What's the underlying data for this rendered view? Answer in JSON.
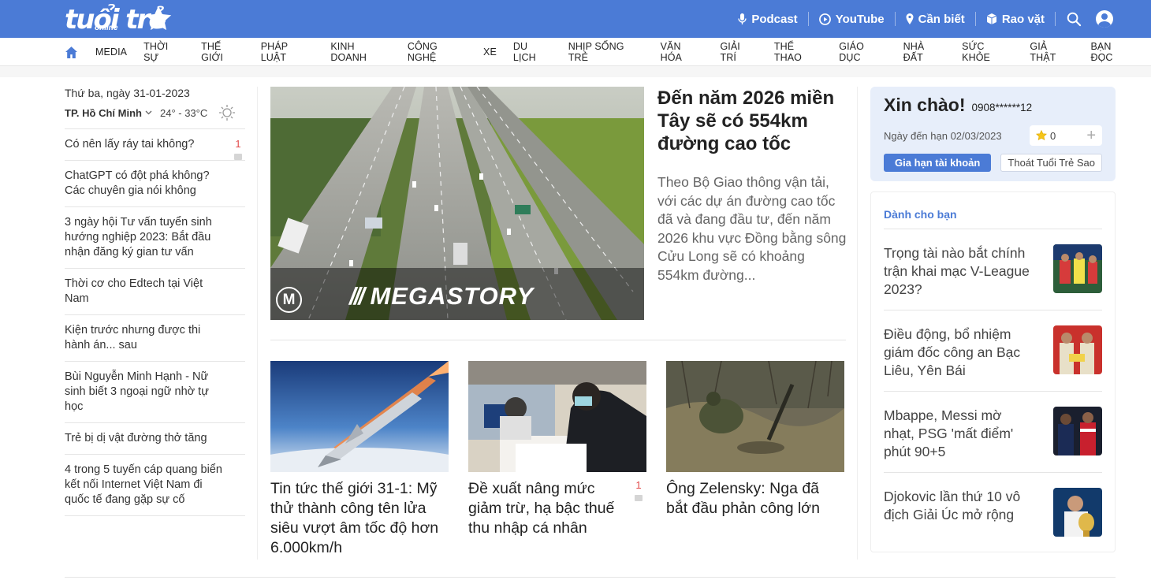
{
  "brand": {
    "logo_text": "tuổi trẻ",
    "logo_sub": "online",
    "color_primary": "#4b7bd6"
  },
  "topnav": {
    "links": [
      {
        "label": "Podcast",
        "icon": "microphone-icon"
      },
      {
        "label": "YouTube",
        "icon": "youtube-icon"
      },
      {
        "label": "Cần biết",
        "icon": "pin-icon"
      },
      {
        "label": "Rao vặt",
        "icon": "cube-icon"
      }
    ]
  },
  "categories": [
    "MEDIA",
    "THỜI SỰ",
    "THẾ GIỚI",
    "PHÁP LUẬT",
    "KINH DOANH",
    "CÔNG NGHỆ",
    "XE",
    "DU LỊCH",
    "NHỊP SỐNG TRẺ",
    "VĂN HÓA",
    "GIẢI TRÍ",
    "THỂ THAO",
    "GIÁO DỤC",
    "NHÀ ĐẤT",
    "SỨC KHỎE",
    "GIẢ THẬT",
    "BẠN ĐỌC"
  ],
  "left": {
    "date": "Thứ ba, ngày 31-01-2023",
    "city": "TP. Hồ Chí Minh",
    "temperature": "24° - 33°C",
    "items": [
      {
        "title": "Có nên lấy ráy tai không?",
        "comments": "1"
      },
      {
        "title": "ChatGPT có đột phá không? Các chuyên gia nói không",
        "comments": ""
      },
      {
        "title": "3 ngày hội Tư vấn tuyển sinh hướng nghiệp 2023: Bắt đầu nhận đăng ký gian tư vấn",
        "comments": ""
      },
      {
        "title": "Thời cơ cho Edtech tại Việt Nam",
        "comments": ""
      },
      {
        "title": "Kiện trước nhưng được thi hành án... sau",
        "comments": ""
      },
      {
        "title": "Bùi Nguyễn Minh Hạnh - Nữ sinh biết 3 ngoại ngữ nhờ tự học",
        "comments": ""
      },
      {
        "title": "Trẻ bị dị vật đường thở tăng",
        "comments": ""
      },
      {
        "title": "4 trong 5 tuyến cáp quang biển kết nối Internet Việt Nam đi quốc tế đang gặp sự cố",
        "comments": ""
      }
    ]
  },
  "hero": {
    "title": "Đến năm 2026 miền Tây sẽ có 554km đường cao tốc",
    "sapo": "Theo Bộ Giao thông vận tải, với các dự án đường cao tốc đã và đang đầu tư, đến năm 2026 khu vực Đồng bằng sông Cửu Long sẽ có khoảng 554km đường...",
    "badge": "M",
    "overlay": "MEGASTORY"
  },
  "cards": [
    {
      "title": "Tin tức thế giới 31-1: Mỹ thử thành công tên lửa siêu vượt âm tốc độ hơn 6.000km/h",
      "comments": ""
    },
    {
      "title": "Đề xuất nâng mức giảm trừ, hạ bậc thuế thu nhập cá nhân",
      "comments": "1"
    },
    {
      "title": "Ông Zelensky: Nga đã bắt đầu phản công lớn",
      "comments": ""
    }
  ],
  "account": {
    "greeting": "Xin chào!",
    "phone": "0908******12",
    "due": "Ngày đến hạn 02/03/2023",
    "stars": "0",
    "renew": "Gia hạn tài khoản",
    "logout": "Thoát Tuổi Trẻ Sao"
  },
  "foryou": {
    "heading": "Dành cho bạn",
    "items": [
      {
        "title": "Trọng tài nào bắt chính trận khai mạc V-League 2023?"
      },
      {
        "title": "Điều động, bổ nhiệm giám đốc công an Bạc Liêu, Yên Bái"
      },
      {
        "title": "Mbappe, Messi mờ nhạt, PSG 'mất điểm' phút 90+5"
      },
      {
        "title": "Djokovic lần thứ 10 vô địch Giải Úc mở rộng"
      }
    ]
  }
}
